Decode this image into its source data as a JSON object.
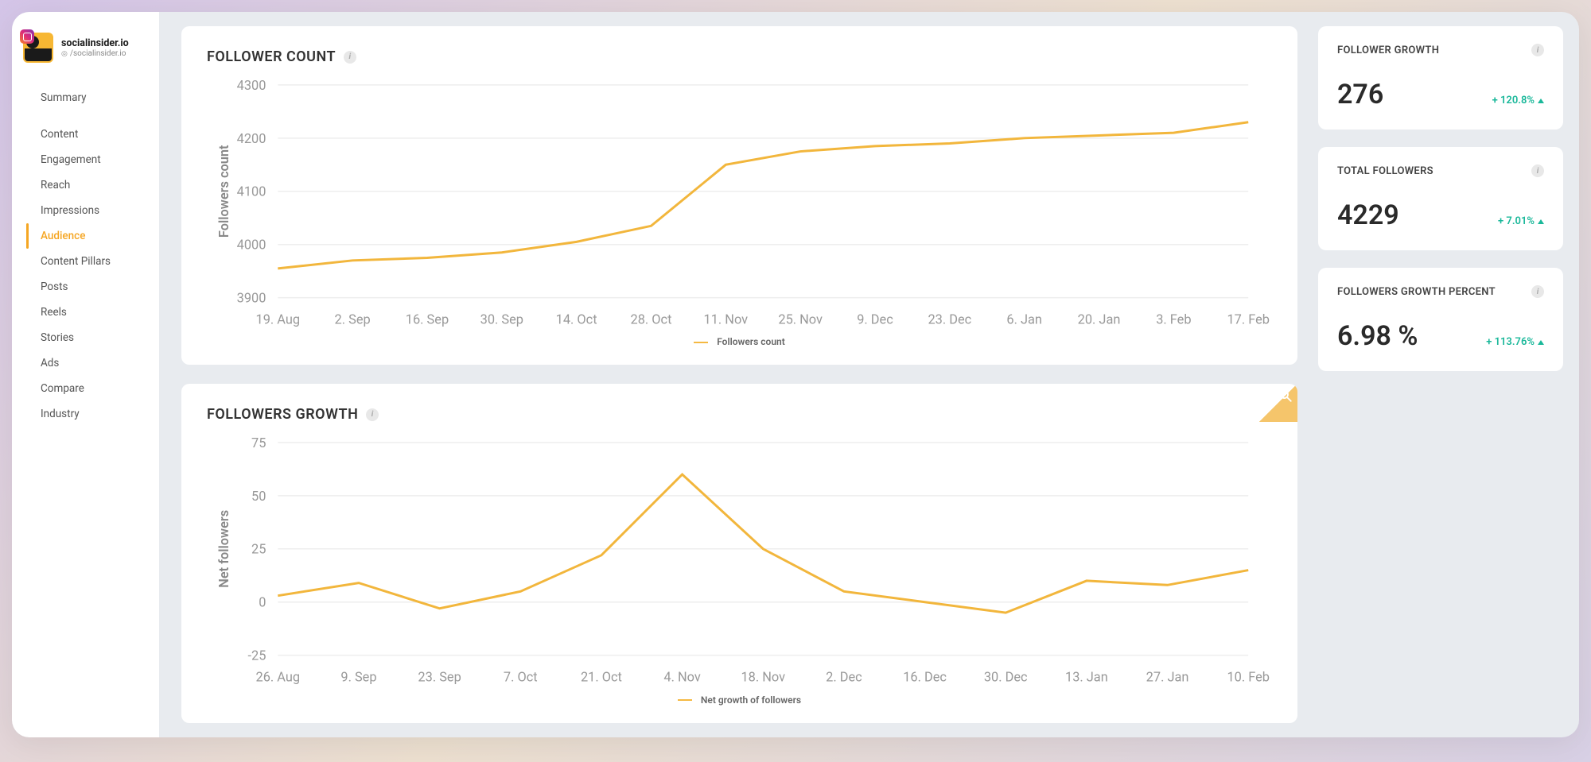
{
  "brand": {
    "name": "socialinsider.io",
    "handle": "/socialinsider.io"
  },
  "sidebar": {
    "items": [
      {
        "label": "Summary",
        "active": false
      },
      {
        "label": "Content",
        "active": false
      },
      {
        "label": "Engagement",
        "active": false
      },
      {
        "label": "Reach",
        "active": false
      },
      {
        "label": "Impressions",
        "active": false
      },
      {
        "label": "Audience",
        "active": true
      },
      {
        "label": "Content Pillars",
        "active": false
      },
      {
        "label": "Posts",
        "active": false
      },
      {
        "label": "Reels",
        "active": false
      },
      {
        "label": "Stories",
        "active": false
      },
      {
        "label": "Ads",
        "active": false
      },
      {
        "label": "Compare",
        "active": false
      },
      {
        "label": "Industry",
        "active": false
      }
    ]
  },
  "charts": {
    "follower_count": {
      "title": "FOLLOWER COUNT",
      "legend": "Followers count",
      "ylabel": "Followers count"
    },
    "followers_growth": {
      "title": "FOLLOWERS GROWTH",
      "legend": "Net growth of followers",
      "ylabel": "Net followers"
    }
  },
  "metrics": [
    {
      "title": "FOLLOWER GROWTH",
      "value": "276",
      "delta": "+ 120.8%"
    },
    {
      "title": "TOTAL FOLLOWERS",
      "value": "4229",
      "delta": "+ 7.01%"
    },
    {
      "title": "FOLLOWERS GROWTH PERCENT",
      "value": "6.98 %",
      "delta": "+ 113.76%"
    }
  ],
  "chart_data": [
    {
      "type": "line",
      "title": "FOLLOWER COUNT",
      "xlabel": "",
      "ylabel": "Followers count",
      "ylim": [
        3900,
        4300
      ],
      "yticks": [
        3900,
        4000,
        4100,
        4200,
        4300
      ],
      "categories": [
        "19. Aug",
        "2. Sep",
        "16. Sep",
        "30. Sep",
        "14. Oct",
        "28. Oct",
        "11. Nov",
        "25. Nov",
        "9. Dec",
        "23. Dec",
        "6. Jan",
        "20. Jan",
        "3. Feb",
        "17. Feb"
      ],
      "series": [
        {
          "name": "Followers count",
          "values": [
            3955,
            3970,
            3975,
            3985,
            4005,
            4035,
            4150,
            4175,
            4185,
            4190,
            4200,
            4205,
            4210,
            4230
          ]
        }
      ]
    },
    {
      "type": "line",
      "title": "FOLLOWERS GROWTH",
      "xlabel": "",
      "ylabel": "Net followers",
      "ylim": [
        -25,
        75
      ],
      "yticks": [
        -25,
        0,
        25,
        50,
        75
      ],
      "categories": [
        "26. Aug",
        "9. Sep",
        "23. Sep",
        "7. Oct",
        "21. Oct",
        "4. Nov",
        "18. Nov",
        "2. Dec",
        "16. Dec",
        "30. Dec",
        "13. Jan",
        "27. Jan",
        "10. Feb"
      ],
      "series": [
        {
          "name": "Net growth of followers",
          "values": [
            3,
            9,
            -3,
            5,
            22,
            60,
            25,
            5,
            0,
            -5,
            10,
            8,
            15
          ]
        }
      ]
    }
  ]
}
